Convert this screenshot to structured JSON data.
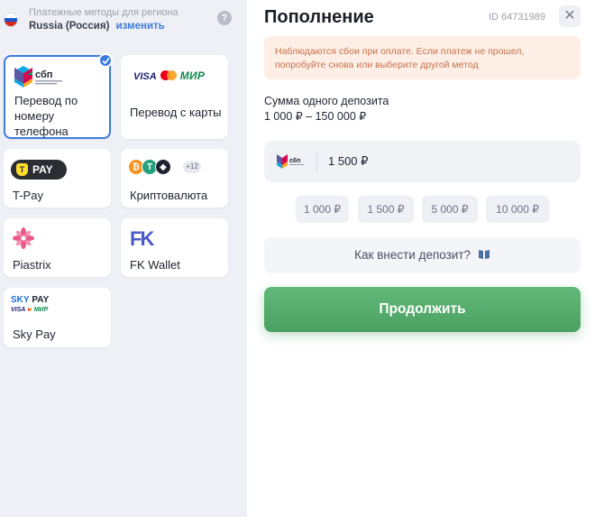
{
  "region": {
    "title": "Платежные методы для региона",
    "country": "Russia (Россия)",
    "change_label": "изменить",
    "help_glyph": "?"
  },
  "methods": [
    {
      "label": "Перевод по номеру телефона",
      "logo": "sbp-logo",
      "selected": true
    },
    {
      "label": "Перевод с карты",
      "logo": "visa-mastercard-mir-logo",
      "selected": false
    },
    {
      "label": "T-Pay",
      "logo": "tpay-logo",
      "selected": false
    },
    {
      "label": "Криптовалюта",
      "logo": "crypto-coins-logo",
      "selected": false,
      "extra_count": "+12"
    },
    {
      "label": "Piastrix",
      "logo": "piastrix-logo",
      "selected": false
    },
    {
      "label": "FK Wallet",
      "logo": "fk-logo",
      "selected": false
    },
    {
      "label": "Sky Pay",
      "logo": "skypay-logo",
      "selected": false
    }
  ],
  "logos": {
    "sbp_text": "сбп",
    "visa": "VISA",
    "mir": "МИР",
    "tpay": "PAY",
    "fk": "FK",
    "skypay_line1_a": "SKY",
    "skypay_line1_b": " PAY",
    "skypay_visa": "VISA",
    "skypay_mir": "МИР"
  },
  "deposit": {
    "title": "Пополнение",
    "order_id": "ID 64731989",
    "close_glyph": "✕",
    "alert": "Наблюдаются сбои при оплате. Если платеж не прошел, попробуйте снова или выберите другой метод",
    "sum_label": "Сумма одного депозита",
    "sum_range": "1 000 ₽ – 150 000 ₽",
    "amount_value": "1 500 ₽",
    "quick_amounts": [
      "1 000 ₽",
      "1 500 ₽",
      "5 000 ₽",
      "10 000 ₽"
    ],
    "howto_label": "Как внести депозит?",
    "continue_label": "Продолжить"
  },
  "colors": {
    "accent_blue": "#3d7be0",
    "cta_green": "#4aa062",
    "alert_bg": "#fdeee6",
    "alert_text": "#c8724a",
    "panel_bg": "#eef0f5"
  }
}
